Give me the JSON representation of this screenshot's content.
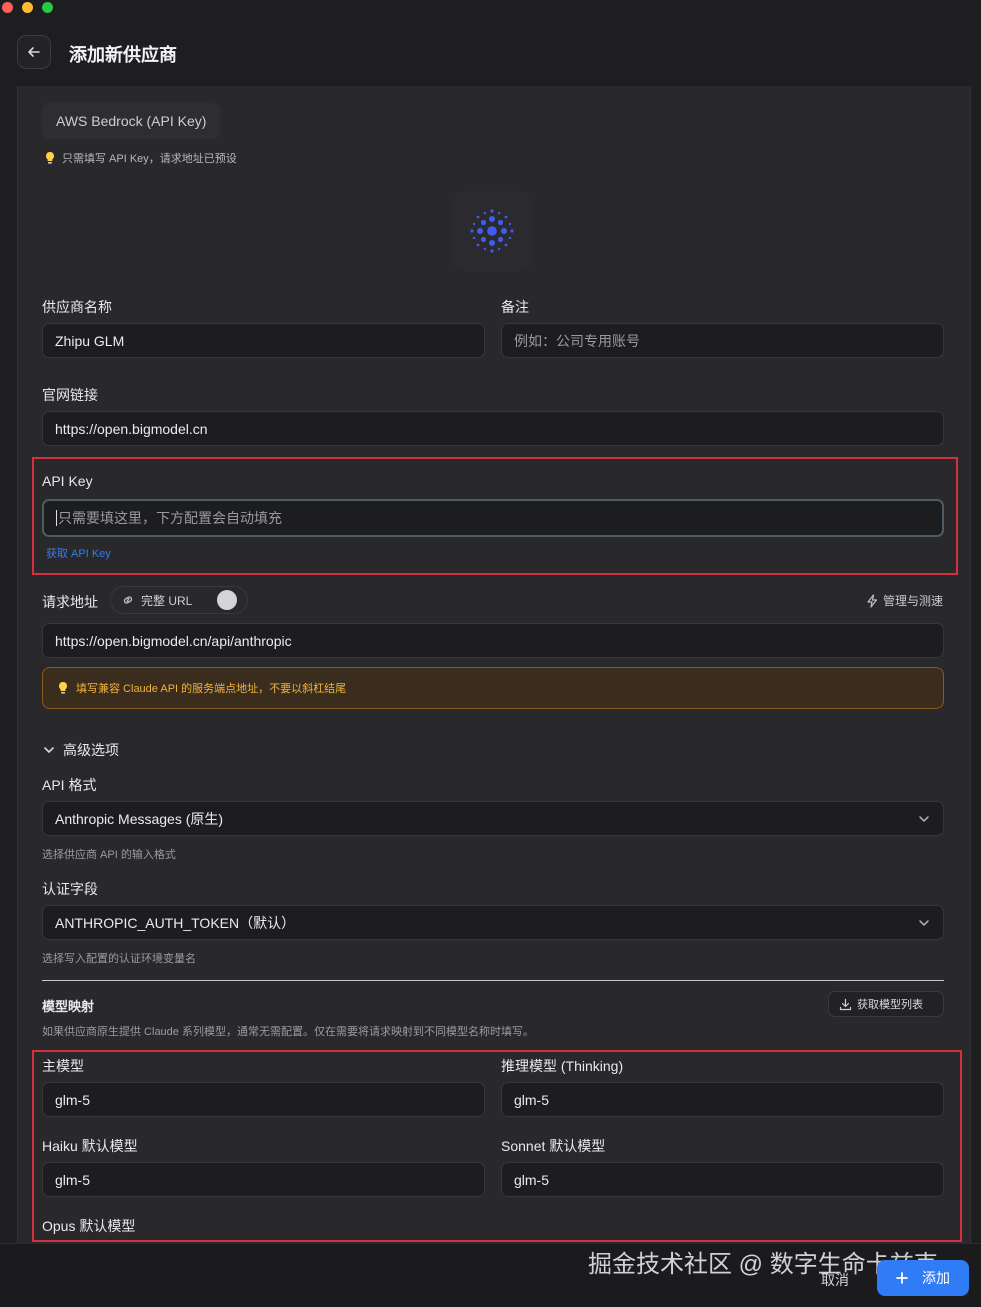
{
  "header": {
    "title": "添加新供应商"
  },
  "preset": {
    "chip_label": "AWS Bedrock (API Key)",
    "tip": "只需填写 API Key，请求地址已预设",
    "logo_icon": "zhipu-logo-icon"
  },
  "form": {
    "provider_name": {
      "label": "供应商名称",
      "value": "Zhipu GLM"
    },
    "notes": {
      "label": "备注",
      "placeholder": "例如：公司专用账号"
    },
    "website": {
      "label": "官网链接",
      "value": "https://open.bigmodel.cn"
    },
    "api_key": {
      "label": "API Key",
      "placeholder": "只需要填这里，下方配置会自动填充",
      "get_link": "获取 API Key"
    },
    "endpoint": {
      "label": "请求地址",
      "full_url_label": "完整 URL",
      "full_url_enabled": false,
      "manage_label": "管理与测速",
      "value": "https://open.bigmodel.cn/api/anthropic",
      "warning": "填写兼容 Claude API 的服务端点地址，不要以斜杠结尾"
    },
    "advanced": {
      "toggle_label": "高级选项",
      "api_format": {
        "label": "API 格式",
        "value": "Anthropic Messages (原生)",
        "hint": "选择供应商 API 的输入格式"
      },
      "auth_field": {
        "label": "认证字段",
        "value": "ANTHROPIC_AUTH_TOKEN（默认）",
        "hint": "选择写入配置的认证环境变量名"
      }
    },
    "model_mapping": {
      "title": "模型映射",
      "fetch_button": "获取模型列表",
      "description": "如果供应商原生提供 Claude 系列模型，通常无需配置。仅在需要将请求映射到不同模型名称时填写。",
      "main_model": {
        "label": "主模型",
        "value": "glm-5"
      },
      "thinking_model": {
        "label": "推理模型 (Thinking)",
        "value": "glm-5"
      },
      "haiku_model": {
        "label": "Haiku 默认模型",
        "value": "glm-5"
      },
      "sonnet_model": {
        "label": "Sonnet 默认模型",
        "value": "glm-5"
      },
      "opus_model": {
        "label": "Opus 默认模型"
      }
    }
  },
  "footer": {
    "cancel": "取消",
    "add": "添加",
    "watermark": "掘金技术社区 @ 数字生命卡兹克"
  },
  "colors": {
    "accent": "#2f7cf6",
    "highlight_box": "#d5303d",
    "warning_text": "#f0b23a",
    "logo": "#3d5cf0"
  }
}
